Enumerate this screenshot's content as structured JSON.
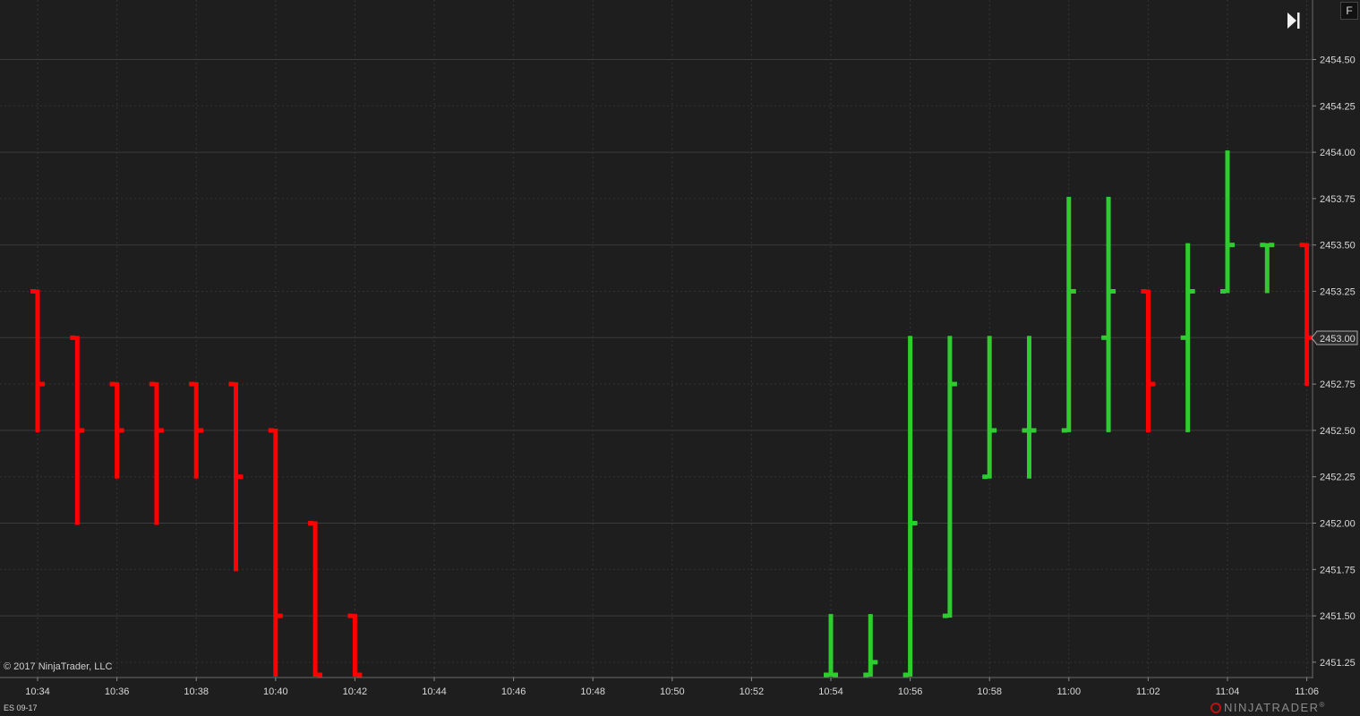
{
  "instrument": "ES 09-17",
  "copyright": "© 2017 NinjaTrader, LLC",
  "brand": {
    "name": "NINJATRADER",
    "suffix": "®"
  },
  "buttons": {
    "f_label": "F"
  },
  "icons": {
    "scroll_to_end": "skip-to-end-icon"
  },
  "colors": {
    "up": "#2ecc2e",
    "down": "#ff0000",
    "background": "#1e1e1e",
    "grid": "#3a3a3a"
  },
  "chart_data": {
    "type": "ohlc",
    "bar_style": "HLC",
    "price_ticks": [
      "2454.50",
      "2454.25",
      "2454.00",
      "2453.75",
      "2453.50",
      "2453.25",
      "2453.00",
      "2452.75",
      "2452.50",
      "2452.25",
      "2452.00",
      "2451.75",
      "2451.50",
      "2451.25"
    ],
    "time_ticks": [
      "10:34",
      "10:36",
      "10:38",
      "10:40",
      "10:42",
      "10:44",
      "10:46",
      "10:48",
      "10:50",
      "10:52",
      "10:54",
      "10:56",
      "10:58",
      "11:00",
      "11:02",
      "11:04",
      "11:06"
    ],
    "ylim": [
      2451.18,
      2454.75
    ],
    "last_price": "2453.00",
    "bars": [
      {
        "t": "10:34",
        "o": 2453.25,
        "h": 2453.25,
        "l": 2452.5,
        "c": 2452.75,
        "dir": "down"
      },
      {
        "t": "10:35",
        "o": 2453.0,
        "h": 2453.0,
        "l": 2452.0,
        "c": 2452.5,
        "dir": "down"
      },
      {
        "t": "10:36",
        "o": 2452.75,
        "h": 2452.75,
        "l": 2452.25,
        "c": 2452.5,
        "dir": "down"
      },
      {
        "t": "10:37",
        "o": 2452.75,
        "h": 2452.75,
        "l": 2452.0,
        "c": 2452.5,
        "dir": "down"
      },
      {
        "t": "10:38",
        "o": 2452.75,
        "h": 2452.75,
        "l": 2452.25,
        "c": 2452.5,
        "dir": "down"
      },
      {
        "t": "10:39",
        "o": 2452.75,
        "h": 2452.75,
        "l": 2451.75,
        "c": 2452.25,
        "dir": "down"
      },
      {
        "t": "10:40",
        "o": 2452.5,
        "h": 2452.5,
        "l": 2451.18,
        "c": 2451.5,
        "dir": "down"
      },
      {
        "t": "10:41",
        "o": 2452.0,
        "h": 2452.0,
        "l": 2451.18,
        "c": 2451.18,
        "dir": "down"
      },
      {
        "t": "10:42",
        "o": 2451.5,
        "h": 2451.5,
        "l": 2451.18,
        "c": 2451.18,
        "dir": "down"
      },
      {
        "t": "10:54",
        "o": 2451.18,
        "h": 2451.5,
        "l": 2451.18,
        "c": 2451.18,
        "dir": "up"
      },
      {
        "t": "10:55",
        "o": 2451.18,
        "h": 2451.5,
        "l": 2451.18,
        "c": 2451.25,
        "dir": "up"
      },
      {
        "t": "10:56",
        "o": 2451.18,
        "h": 2453.0,
        "l": 2451.18,
        "c": 2452.0,
        "dir": "up"
      },
      {
        "t": "10:57",
        "o": 2451.5,
        "h": 2453.0,
        "l": 2451.5,
        "c": 2452.75,
        "dir": "up"
      },
      {
        "t": "10:58",
        "o": 2452.25,
        "h": 2453.0,
        "l": 2452.25,
        "c": 2452.5,
        "dir": "up"
      },
      {
        "t": "10:59",
        "o": 2452.5,
        "h": 2453.0,
        "l": 2452.25,
        "c": 2452.5,
        "dir": "up"
      },
      {
        "t": "11:00",
        "o": 2452.5,
        "h": 2453.75,
        "l": 2452.5,
        "c": 2453.25,
        "dir": "up"
      },
      {
        "t": "11:01",
        "o": 2453.0,
        "h": 2453.75,
        "l": 2452.5,
        "c": 2453.25,
        "dir": "up"
      },
      {
        "t": "11:02",
        "o": 2453.25,
        "h": 2453.25,
        "l": 2452.5,
        "c": 2452.75,
        "dir": "down"
      },
      {
        "t": "11:03",
        "o": 2453.0,
        "h": 2453.5,
        "l": 2452.5,
        "c": 2453.25,
        "dir": "up"
      },
      {
        "t": "11:04",
        "o": 2453.25,
        "h": 2454.0,
        "l": 2453.25,
        "c": 2453.5,
        "dir": "up"
      },
      {
        "t": "11:05",
        "o": 2453.5,
        "h": 2453.5,
        "l": 2453.25,
        "c": 2453.5,
        "dir": "up"
      },
      {
        "t": "11:06",
        "o": 2453.5,
        "h": 2453.5,
        "l": 2452.75,
        "c": 2453.0,
        "dir": "down"
      }
    ]
  }
}
